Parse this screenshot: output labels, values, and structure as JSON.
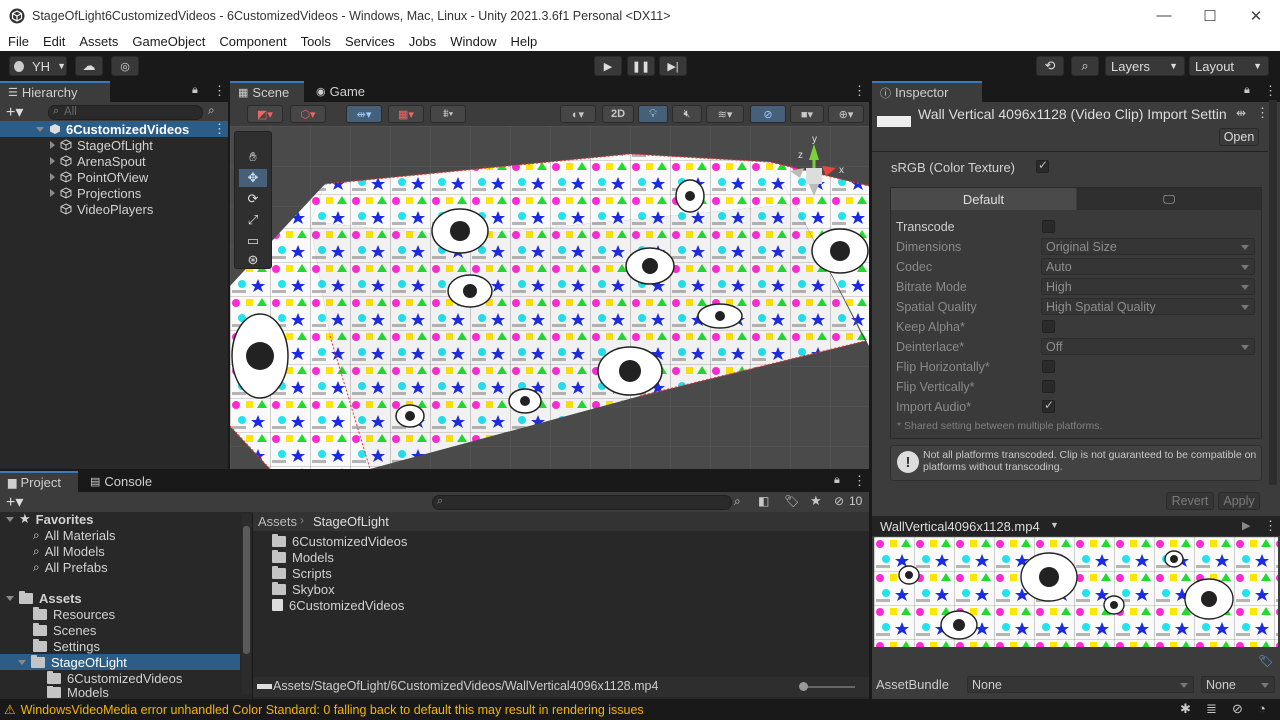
{
  "window": {
    "title": "StageOfLight6CustomizedVideos - 6CustomizedVideos - Windows, Mac, Linux - Unity 2021.3.6f1 Personal <DX11>"
  },
  "menu": [
    "File",
    "Edit",
    "Assets",
    "GameObject",
    "Component",
    "Tools",
    "Services",
    "Jobs",
    "Window",
    "Help"
  ],
  "toolbar": {
    "account": "YH",
    "layers": "Layers",
    "layout": "Layout"
  },
  "hierarchy": {
    "tab": "Hierarchy",
    "search_placeholder": "All",
    "scene": "6CustomizedVideos",
    "items": [
      "StageOfLight",
      "ArenaSpout",
      "PointOfView",
      "Projections",
      "VideoPlayers"
    ]
  },
  "scene_view": {
    "tabs": [
      "Scene",
      "Game"
    ],
    "mode_2d": "2D",
    "gizmo_axes": {
      "x": "x",
      "y": "y",
      "z": "z"
    }
  },
  "inspector": {
    "tab": "Inspector",
    "title": "Wall Vertical 4096x1128 (Video Clip) Import Settin",
    "open_label": "Open",
    "srgb_label": "sRGB (Color Texture)",
    "platform_tabs": [
      "Default"
    ],
    "fields": [
      {
        "label": "Transcode",
        "type": "check",
        "value": false
      },
      {
        "label": "Dimensions",
        "type": "dropdown",
        "value": "Original Size"
      },
      {
        "label": "Codec",
        "type": "dropdown",
        "value": "Auto"
      },
      {
        "label": "Bitrate Mode",
        "type": "dropdown",
        "value": "High"
      },
      {
        "label": "Spatial Quality",
        "type": "dropdown",
        "value": "High Spatial Quality"
      },
      {
        "label": "Keep Alpha*",
        "type": "check",
        "value": false
      },
      {
        "label": "Deinterlace*",
        "type": "dropdown",
        "value": "Off"
      },
      {
        "label": "Flip Horizontally*",
        "type": "check",
        "value": false
      },
      {
        "label": "Flip Vertically*",
        "type": "check",
        "value": false
      },
      {
        "label": "Import Audio*",
        "type": "check",
        "value": true
      }
    ],
    "shared_note": "* Shared setting between multiple platforms.",
    "warning": "Not all platforms transcoded. Clip is not guaranteed to be compatible on platforms without transcoding.",
    "revert": "Revert",
    "apply": "Apply",
    "preview_title": "WallVertical4096x1128.mp4",
    "assetbundle_label": "AssetBundle",
    "assetbundle_value": "None",
    "assetbundle_variant": "None"
  },
  "project": {
    "tabs": [
      "Project",
      "Console"
    ],
    "badge_count": "10",
    "favorites_label": "Favorites",
    "favorites": [
      "All Materials",
      "All Models",
      "All Prefabs"
    ],
    "assets_label": "Assets",
    "asset_folders": [
      "Resources",
      "Scenes",
      "Settings",
      "StageOfLight"
    ],
    "stage_children": [
      "6CustomizedVideos",
      "Models"
    ],
    "breadcrumb": [
      "Assets",
      "StageOfLight"
    ],
    "files": [
      "6CustomizedVideos",
      "Models",
      "Scripts",
      "Skybox",
      "6CustomizedVideos"
    ],
    "path": "Assets/StageOfLight/6CustomizedVideos/WallVertical4096x1128.mp4"
  },
  "status": {
    "message": "WindowsVideoMedia error unhandled Color Standard: 0  falling back to default this may result in rendering issues"
  },
  "colors": {
    "selection": "#2c5d87",
    "accent": "#3a79bb",
    "warning": "#f4b400"
  }
}
